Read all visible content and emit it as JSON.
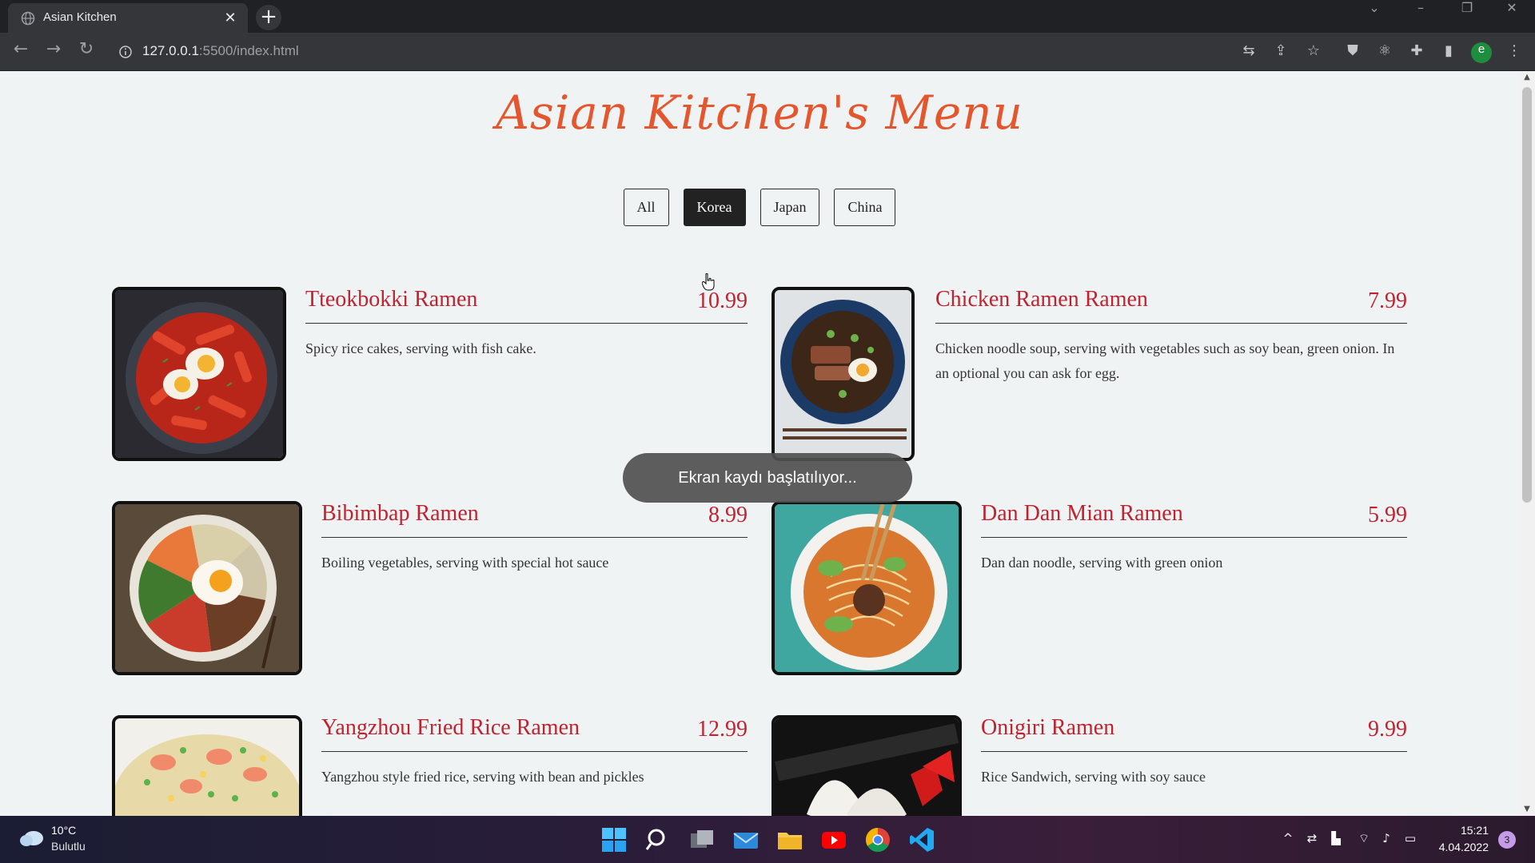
{
  "browser": {
    "tab_title": "Asian Kitchen",
    "url_host": "127.0.0.1",
    "url_rest": ":5500/index.html",
    "profile_initial": "e"
  },
  "page": {
    "title": "Asian Kitchen's Menu",
    "filters": [
      "All",
      "Korea",
      "Japan",
      "China"
    ],
    "active_filter": "Korea",
    "items": [
      {
        "name": "Tteokbokki Ramen",
        "price": "10.99",
        "desc": "Spicy rice cakes, serving with fish cake."
      },
      {
        "name": "Chicken Ramen Ramen",
        "price": "7.99",
        "desc": "Chicken noodle soup, serving with vegetables such as soy bean, green onion. In an optional you can ask for egg."
      },
      {
        "name": "Bibimbap Ramen",
        "price": "8.99",
        "desc": "Boiling vegetables, serving with special hot sauce"
      },
      {
        "name": "Dan Dan Mian Ramen",
        "price": "5.99",
        "desc": "Dan dan noodle, serving with green onion"
      },
      {
        "name": "Yangzhou Fried Rice Ramen",
        "price": "12.99",
        "desc": "Yangzhou style fried rice, serving with bean and pickles"
      },
      {
        "name": "Onigiri Ramen",
        "price": "9.99",
        "desc": "Rice Sandwich, serving with soy sauce"
      }
    ],
    "toast": "Ekran kaydı başlatılıyor..."
  },
  "taskbar": {
    "temp": "10°C",
    "condition": "Bulutlu",
    "time": "15:21",
    "date": "4.04.2022",
    "notifications": "3"
  },
  "colors": {
    "accent_title": "#e4572e",
    "item_red": "#c0232f",
    "page_bg": "#f0f3f4"
  }
}
